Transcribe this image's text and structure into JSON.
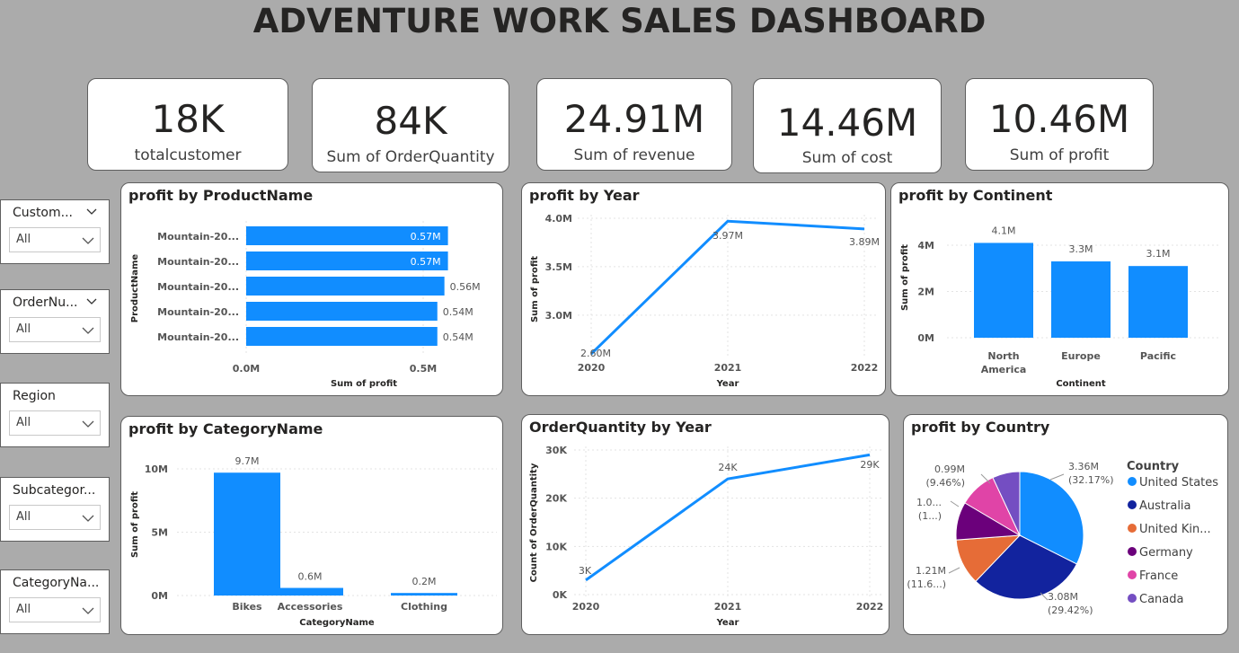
{
  "dashboard": {
    "title": "ADVENTURE WORK SALES DASHBOARD"
  },
  "kpis": [
    {
      "value": "18K",
      "label": "totalcustomer"
    },
    {
      "value": "84K",
      "label": "Sum of OrderQuantity"
    },
    {
      "value": "24.91M",
      "label": "Sum of revenue"
    },
    {
      "value": "14.46M",
      "label": "Sum of cost"
    },
    {
      "value": "10.46M",
      "label": "Sum of profit"
    }
  ],
  "slicers": [
    {
      "title": "Custom...",
      "value": "All"
    },
    {
      "title": "OrderNu...",
      "value": "All"
    },
    {
      "title": "Region",
      "value": "All"
    },
    {
      "title": "Subcategor...",
      "value": "All"
    },
    {
      "title": "CategoryNa...",
      "value": "All"
    }
  ],
  "colors": {
    "accent": "#118dff",
    "navy": "#12239e",
    "orange": "#e66c37",
    "purple": "#6b007b",
    "pink": "#e044a7",
    "violet": "#744ec2"
  },
  "chart_data": [
    {
      "id": "profit_by_product",
      "title": "profit by ProductName",
      "type": "bar",
      "orientation": "horizontal",
      "categories": [
        "Mountain-20...",
        "Mountain-20...",
        "Mountain-20...",
        "Mountain-20...",
        "Mountain-20..."
      ],
      "values": [
        0.57,
        0.57,
        0.56,
        0.54,
        0.54
      ],
      "data_labels": [
        "0.57M",
        "0.57M",
        "0.56M",
        "0.54M",
        "0.54M"
      ],
      "ticks": [
        "0.0M",
        "0.5M"
      ],
      "xlabel": "Sum of profit",
      "ylabel": "ProductName",
      "xlim": [
        0,
        0.5
      ]
    },
    {
      "id": "profit_by_year",
      "title": "profit by Year",
      "type": "line",
      "x": [
        "2020",
        "2021",
        "2022"
      ],
      "values": [
        2.6,
        3.97,
        3.89
      ],
      "data_labels": [
        "2.60M",
        "3.97M",
        "3.89M"
      ],
      "ticks": [
        "4.0M",
        "3.5M",
        "3.0M"
      ],
      "xlabel": "Year",
      "ylabel": "Sum of profit",
      "ylim": [
        2.6,
        4.0
      ]
    },
    {
      "id": "profit_by_continent",
      "title": "profit by Continent",
      "type": "bar",
      "categories": [
        "North America",
        "Europe",
        "Pacific"
      ],
      "category_lines": [
        [
          "North",
          "America"
        ],
        [
          "Europe"
        ],
        [
          "Pacific"
        ]
      ],
      "values": [
        4.1,
        3.3,
        3.1
      ],
      "data_labels": [
        "4.1M",
        "3.3M",
        "3.1M"
      ],
      "ticks": [
        "4M",
        "2M",
        "0M"
      ],
      "xlabel": "Continent",
      "ylabel": "Sum of profit",
      "ylim": [
        0,
        4
      ]
    },
    {
      "id": "profit_by_category",
      "title": "profit by CategoryName",
      "type": "bar",
      "categories": [
        "Bikes",
        "Accessories",
        "Clothing"
      ],
      "values": [
        9.7,
        0.6,
        0.2
      ],
      "data_labels": [
        "9.7M",
        "0.6M",
        "0.2M"
      ],
      "ticks": [
        "10M",
        "5M",
        "0M"
      ],
      "xlabel": "CategoryName",
      "ylabel": "Sum of profit",
      "ylim": [
        0,
        10
      ]
    },
    {
      "id": "orderqty_by_year",
      "title": "OrderQuantity by Year",
      "type": "line",
      "x": [
        "2020",
        "2021",
        "2022"
      ],
      "values": [
        3,
        24,
        29
      ],
      "data_labels": [
        "3K",
        "24K",
        "29K"
      ],
      "ticks": [
        "30K",
        "20K",
        "10K",
        "0K"
      ],
      "xlabel": "Year",
      "ylabel": "Count of OrderQuantity",
      "ylim": [
        0,
        30
      ]
    },
    {
      "id": "profit_by_country",
      "title": "profit by Country",
      "type": "pie",
      "legend_title": "Country",
      "legend_position": "right",
      "categories": [
        "United States",
        "Australia",
        "United Kin...",
        "Germany",
        "France",
        "Canada"
      ],
      "values": [
        3.36,
        3.08,
        1.21,
        1.0,
        0.99,
        0.72
      ],
      "percentages": [
        32.17,
        29.42,
        11.6,
        9.7,
        9.46,
        6.9
      ],
      "data_labels": [
        [
          "3.36M",
          "(32.17%)"
        ],
        [
          "3.08M",
          "(29.42%)"
        ],
        [
          "1.21M",
          "(11.6...)"
        ],
        [
          "1.0...",
          "(1...)"
        ],
        [
          "0.99M",
          "(9.46%)"
        ],
        [
          "",
          ""
        ]
      ]
    }
  ]
}
